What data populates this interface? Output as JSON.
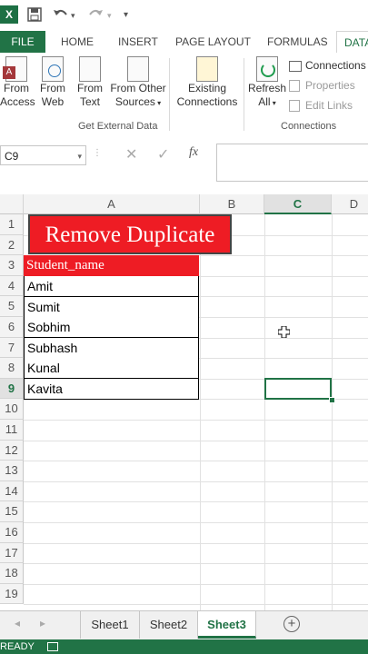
{
  "app": {
    "logo_letter": "X",
    "name_box": "C9",
    "fx_label": "fx"
  },
  "ribbon_tabs": {
    "file": "FILE",
    "home": "HOME",
    "insert": "INSERT",
    "page_layout": "PAGE LAYOUT",
    "formulas": "FORMULAS",
    "data": "DATA"
  },
  "ribbon": {
    "get_external": {
      "label": "Get External Data",
      "from_access": [
        "From",
        "Access"
      ],
      "from_web": [
        "From",
        "Web"
      ],
      "from_text": [
        "From",
        "Text"
      ],
      "from_other": [
        "From Other",
        "Sources"
      ]
    },
    "existing": [
      "Existing",
      "Connections"
    ],
    "refresh": [
      "Refresh",
      "All"
    ],
    "connections": {
      "label": "Connections",
      "items": [
        "Connections",
        "Properties",
        "Edit Links"
      ]
    }
  },
  "grid": {
    "columns": [
      "A",
      "B",
      "C",
      "D"
    ],
    "rows": [
      "1",
      "2",
      "3",
      "4",
      "5",
      "6",
      "7",
      "8",
      "9",
      "10",
      "11",
      "12",
      "13",
      "14",
      "15",
      "16",
      "17",
      "18",
      "19"
    ],
    "active_row": "9",
    "active_col": "C",
    "title": "Remove Duplicate",
    "header": "Student_name",
    "names": [
      "Amit",
      "Sumit",
      "Sobhim",
      "Subhash",
      "Kunal",
      "Kavita"
    ]
  },
  "sheets": [
    "Sheet1",
    "Sheet2",
    "Sheet3"
  ],
  "active_sheet": "Sheet3",
  "status": {
    "text": "READY"
  },
  "colors": {
    "accent": "#217346",
    "banner": "#ee1c24"
  }
}
